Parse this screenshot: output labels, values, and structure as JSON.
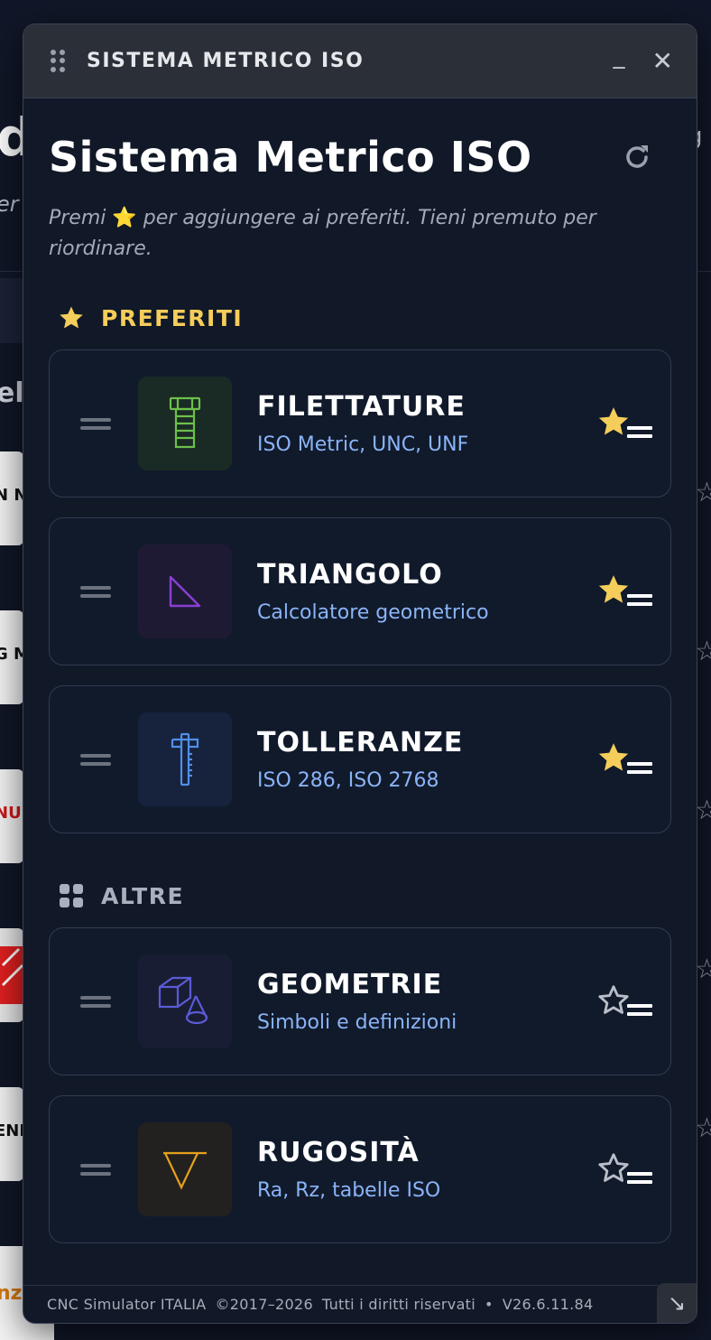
{
  "background": {
    "heading_fragment": "d",
    "subtitle_fragment": "er",
    "list_fragment": "el",
    "right_fragment": "g",
    "card_fragments": [
      "N N",
      "G M",
      "NU",
      "",
      "ENH",
      ""
    ],
    "bottom_fragment": "nzu"
  },
  "window": {
    "title": "SISTEMA METRICO ISO",
    "minimize_label": "_",
    "close_label": "✕"
  },
  "header": {
    "title": "Sistema Metrico ISO",
    "hint_before": "Premi",
    "hint_star": "⭐",
    "hint_after": " per aggiungere ai preferiti. Tieni premuto per riordinare."
  },
  "sections": {
    "favorites_label": "PREFERITI",
    "others_label": "ALTRE"
  },
  "favorites": [
    {
      "title": "FILETTATURE",
      "subtitle": "ISO Metric, UNC, UNF",
      "icon": "screw-icon",
      "favorite": true
    },
    {
      "title": "TRIANGOLO",
      "subtitle": "Calcolatore geometrico",
      "icon": "triangle-icon",
      "favorite": true
    },
    {
      "title": "TOLLERANZE",
      "subtitle": "ISO 286, ISO 2768",
      "icon": "caliper-icon",
      "favorite": true
    }
  ],
  "others": [
    {
      "title": "GEOMETRIE",
      "subtitle": "Simboli e definizioni",
      "icon": "cube-cone-icon",
      "favorite": false
    },
    {
      "title": "RUGOSITÀ",
      "subtitle": "Ra, Rz, tabelle ISO",
      "icon": "roughness-icon",
      "favorite": false
    }
  ],
  "footer": {
    "app": "CNC Simulator ITALIA",
    "copyright": "©2017–2026",
    "rights": "Tutti i diritti riservati",
    "separator": "•",
    "version": "V26.6.11.84",
    "resize_label": "↘"
  },
  "colors": {
    "accent_blue": "#8ab4f8",
    "star_gold": "#f5cd5a",
    "screw_green": "#6cc04a",
    "triangle_purple": "#8a3fd1",
    "caliper_blue": "#4f8fe8",
    "geometry_indigo": "#5b5bd6",
    "roughness_orange": "#e5a11c"
  }
}
